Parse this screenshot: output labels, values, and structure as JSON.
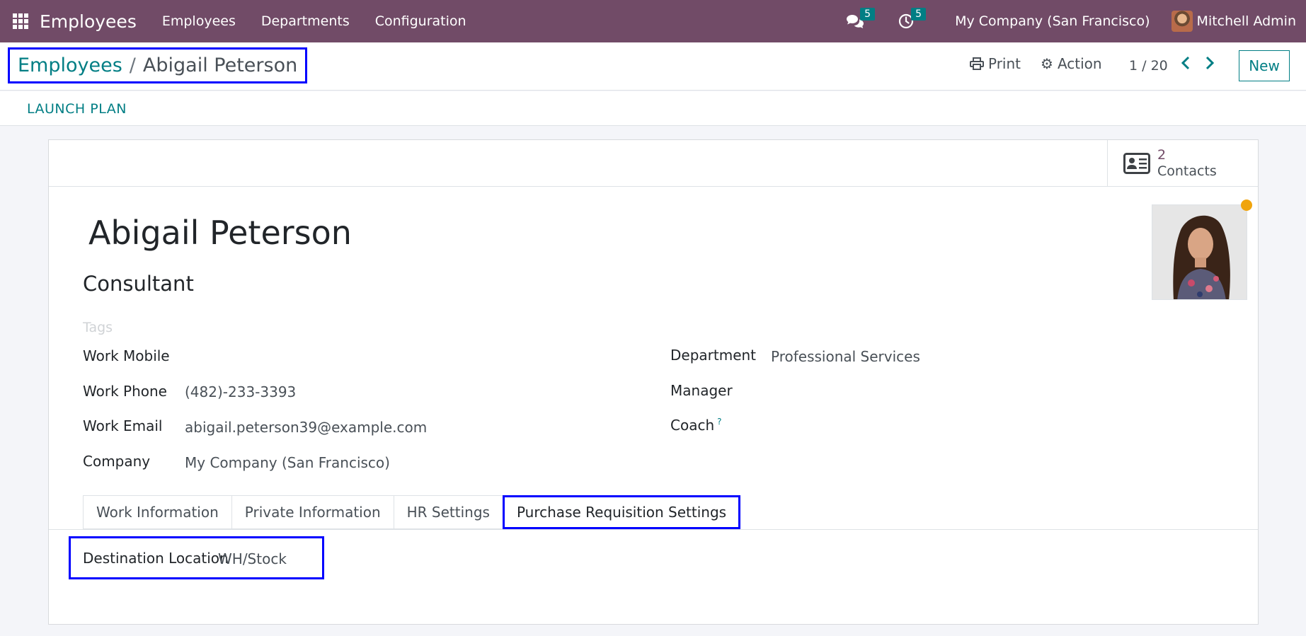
{
  "navbar": {
    "app_name": "Employees",
    "menu": [
      "Employees",
      "Departments",
      "Configuration"
    ],
    "messages_count": "5",
    "activities_count": "5",
    "company": "My Company (San Francisco)",
    "user": "Mitchell Admin"
  },
  "breadcrumb": {
    "parent": "Employees",
    "separator": "/",
    "current": "Abigail Peterson"
  },
  "control_panel": {
    "print_label": "Print",
    "action_label": "Action",
    "pager": "1 / 20",
    "new_label": "New"
  },
  "statusbar": {
    "launch_plan_label": "LAUNCH PLAN"
  },
  "smart_button": {
    "count": "2",
    "label": "Contacts"
  },
  "employee": {
    "name": "Abigail Peterson",
    "job_title": "Consultant",
    "tags_placeholder": "Tags"
  },
  "fields": {
    "work_mobile": {
      "label": "Work Mobile",
      "value": ""
    },
    "work_phone": {
      "label": "Work Phone",
      "value": "(482)-233-3393"
    },
    "work_email": {
      "label": "Work Email",
      "value": "abigail.peterson39@example.com"
    },
    "company": {
      "label": "Company",
      "value": "My Company (San Francisco)"
    },
    "department": {
      "label": "Department",
      "value": "Professional Services"
    },
    "manager": {
      "label": "Manager",
      "value": ""
    },
    "coach": {
      "label": "Coach",
      "help": "?",
      "value": ""
    }
  },
  "tabs": [
    "Work Information",
    "Private Information",
    "HR Settings",
    "Purchase Requisition Settings"
  ],
  "active_tab": "Purchase Requisition Settings",
  "purchase_requisition": {
    "destination_label": "Destination Location",
    "destination_value": "WH/Stock"
  },
  "colors": {
    "navbar": "#714b67",
    "accent": "#017e84",
    "highlight": "#0000ff",
    "status_dot": "#f0a40c"
  }
}
